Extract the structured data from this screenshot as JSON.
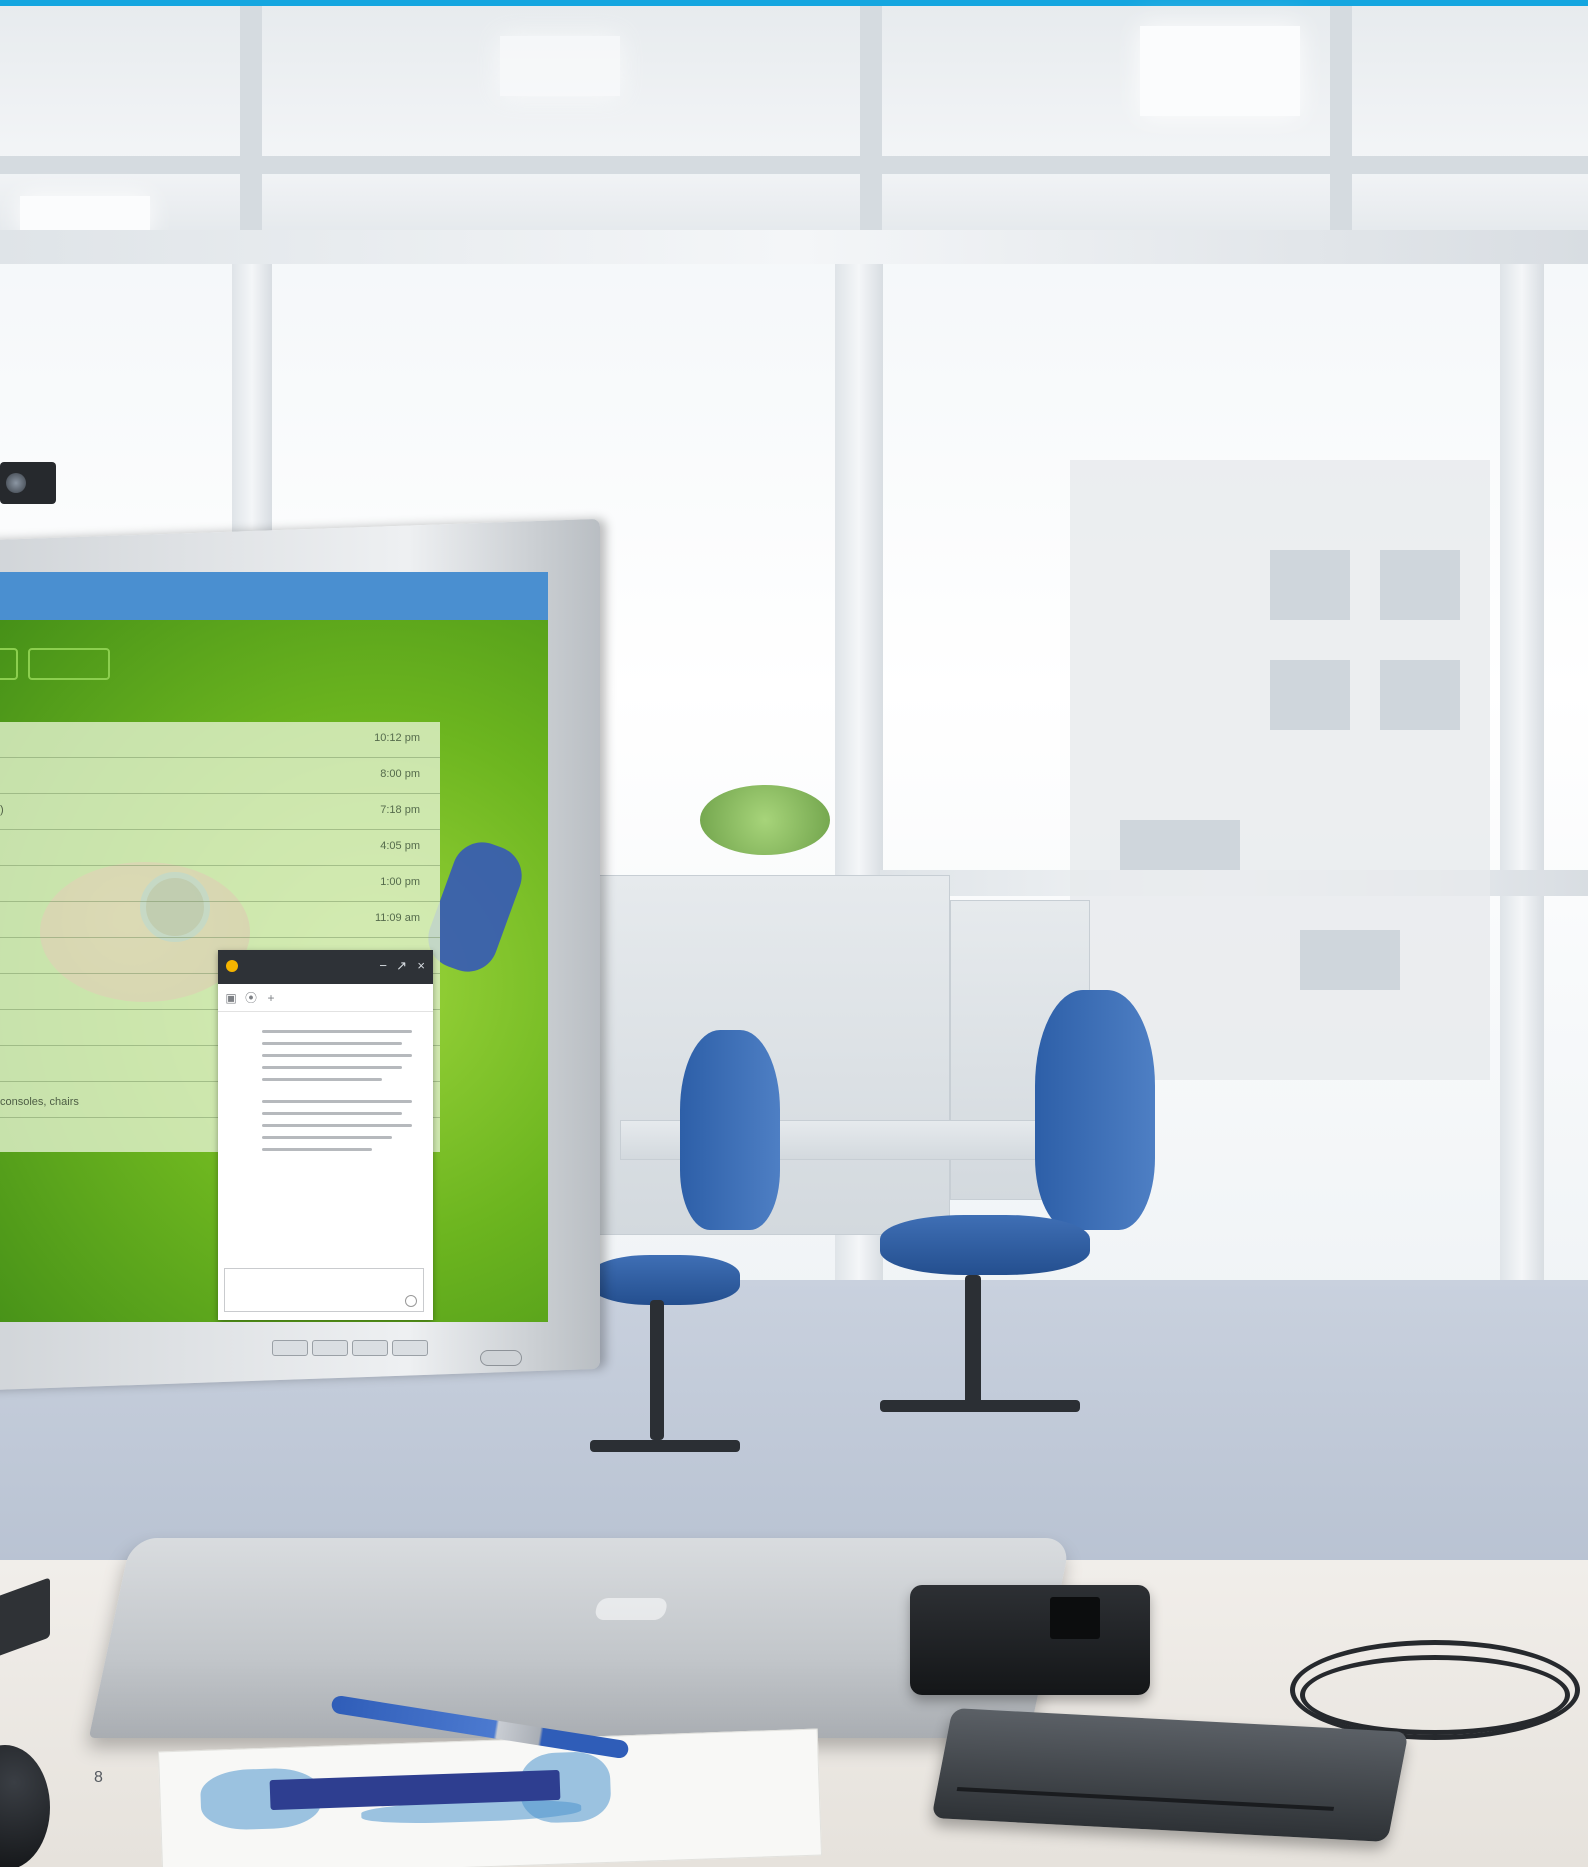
{
  "colors": {
    "accent_bar": "#14a6e0"
  },
  "monitor": {
    "email_times": [
      "10:12 pm",
      "8:00 pm",
      "7:18 pm",
      "4:05 pm",
      "1:00 pm",
      "11:09 am"
    ],
    "snippet_upper": ")",
    "snippet_lower": "consoles, chairs"
  },
  "page": {
    "number": "8"
  }
}
